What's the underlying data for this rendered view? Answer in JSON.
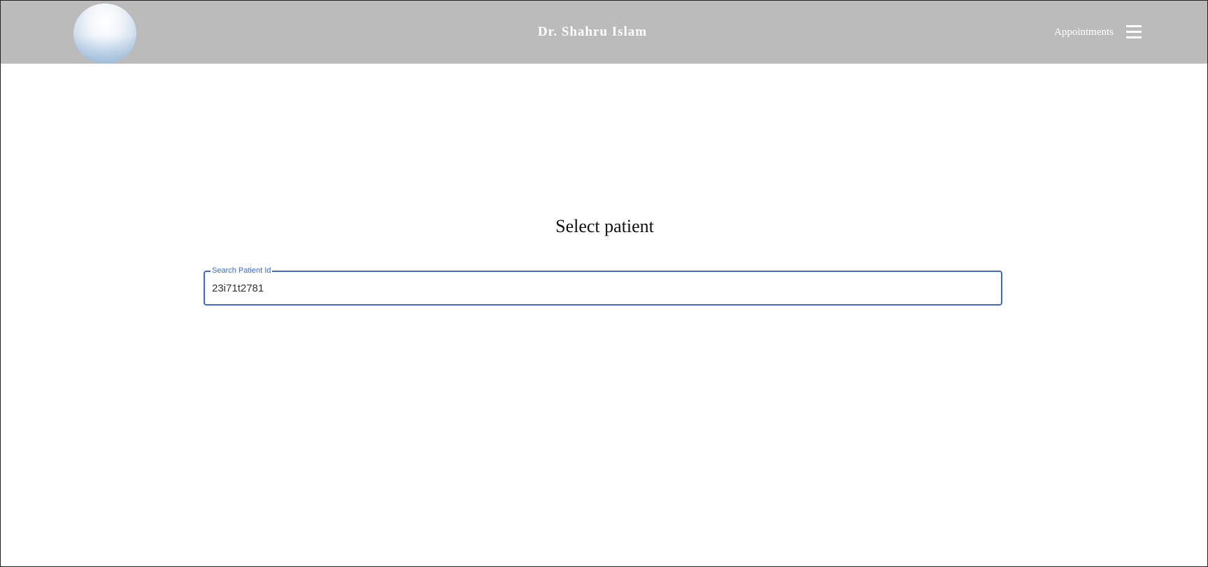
{
  "header": {
    "logo_icon": "watercolor-circle-logo",
    "title": "Dr. Shahru Islam",
    "nav_link": "Appointments",
    "menu_icon": "hamburger-menu-icon",
    "background_color": "#bbbbbb"
  },
  "main": {
    "heading": "Select patient",
    "search": {
      "label": "Search Patient Id",
      "value": "23i71t2781",
      "accent_color": "#3f68c9"
    }
  }
}
